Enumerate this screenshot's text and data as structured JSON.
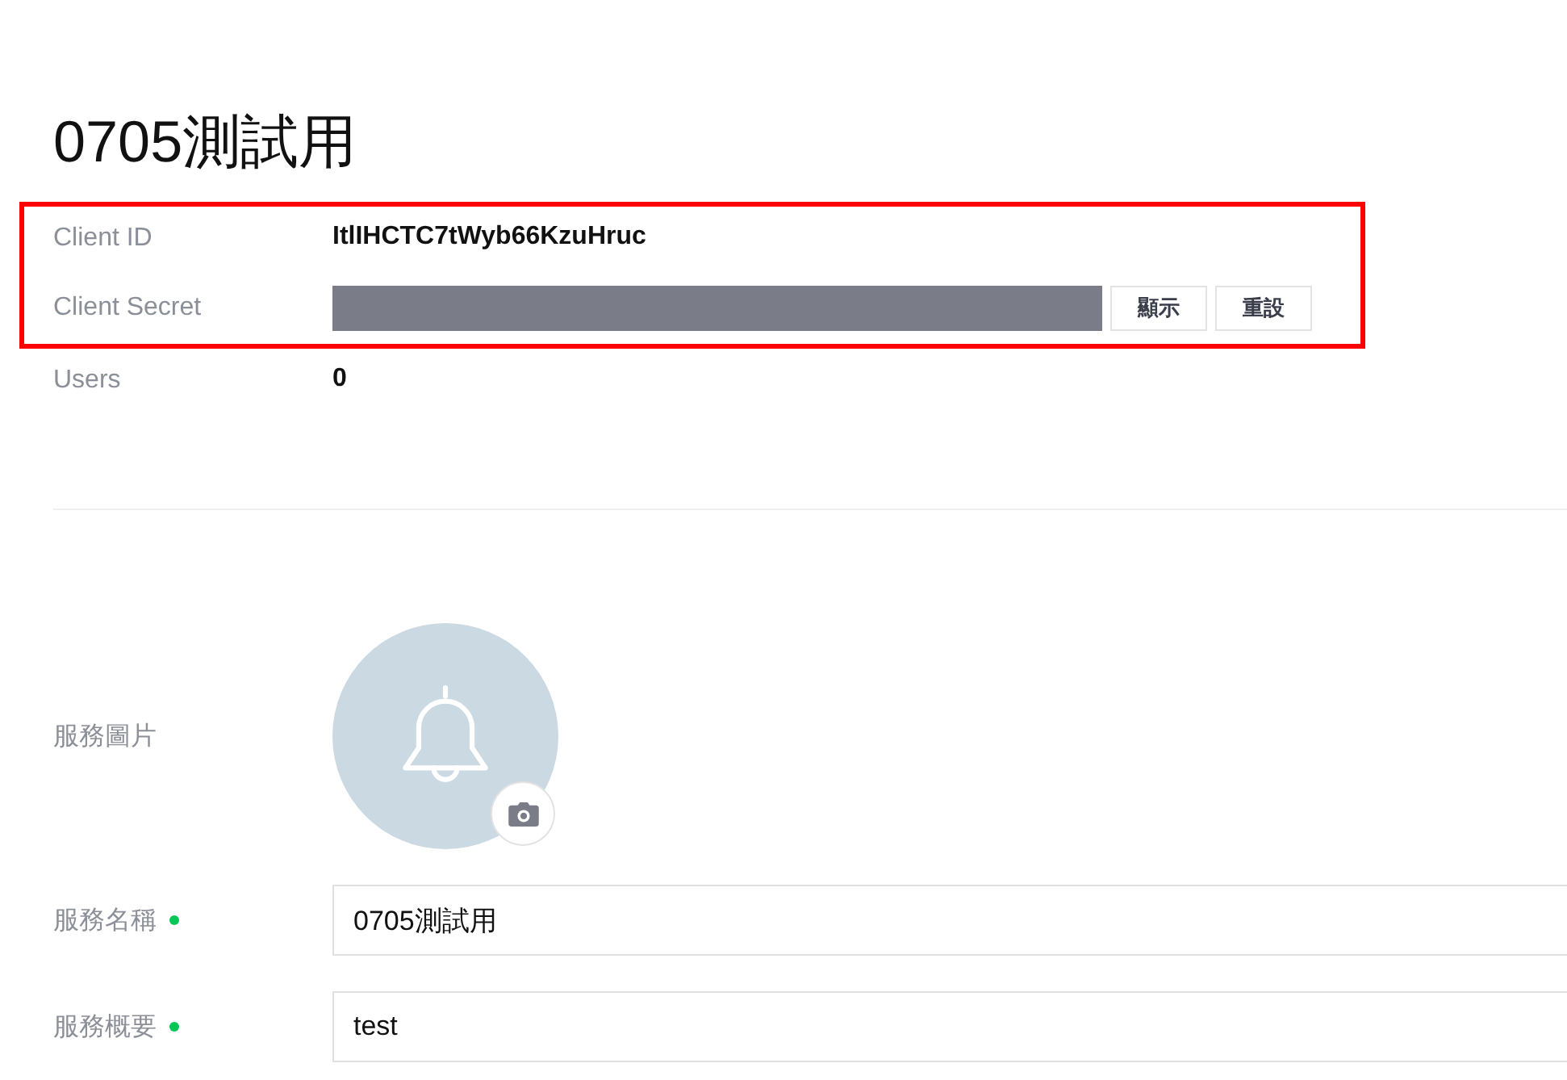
{
  "title": "0705測試用",
  "credentials": {
    "highlighted": true,
    "rows": [
      {
        "kind": "text",
        "label": "Client ID",
        "value": "ItlIHCTC7tWyb66KzuHruc"
      },
      {
        "kind": "secret",
        "label": "Client Secret",
        "buttons": [
          "顯示",
          "重設"
        ]
      }
    ]
  },
  "stats": [
    {
      "label": "Users",
      "value": "0"
    }
  ],
  "service": {
    "image_label": "服務圖片",
    "fields": [
      {
        "label": "服務名稱",
        "required": true,
        "value": "0705測試用"
      },
      {
        "label": "服務概要",
        "required": true,
        "value": "test"
      }
    ]
  }
}
